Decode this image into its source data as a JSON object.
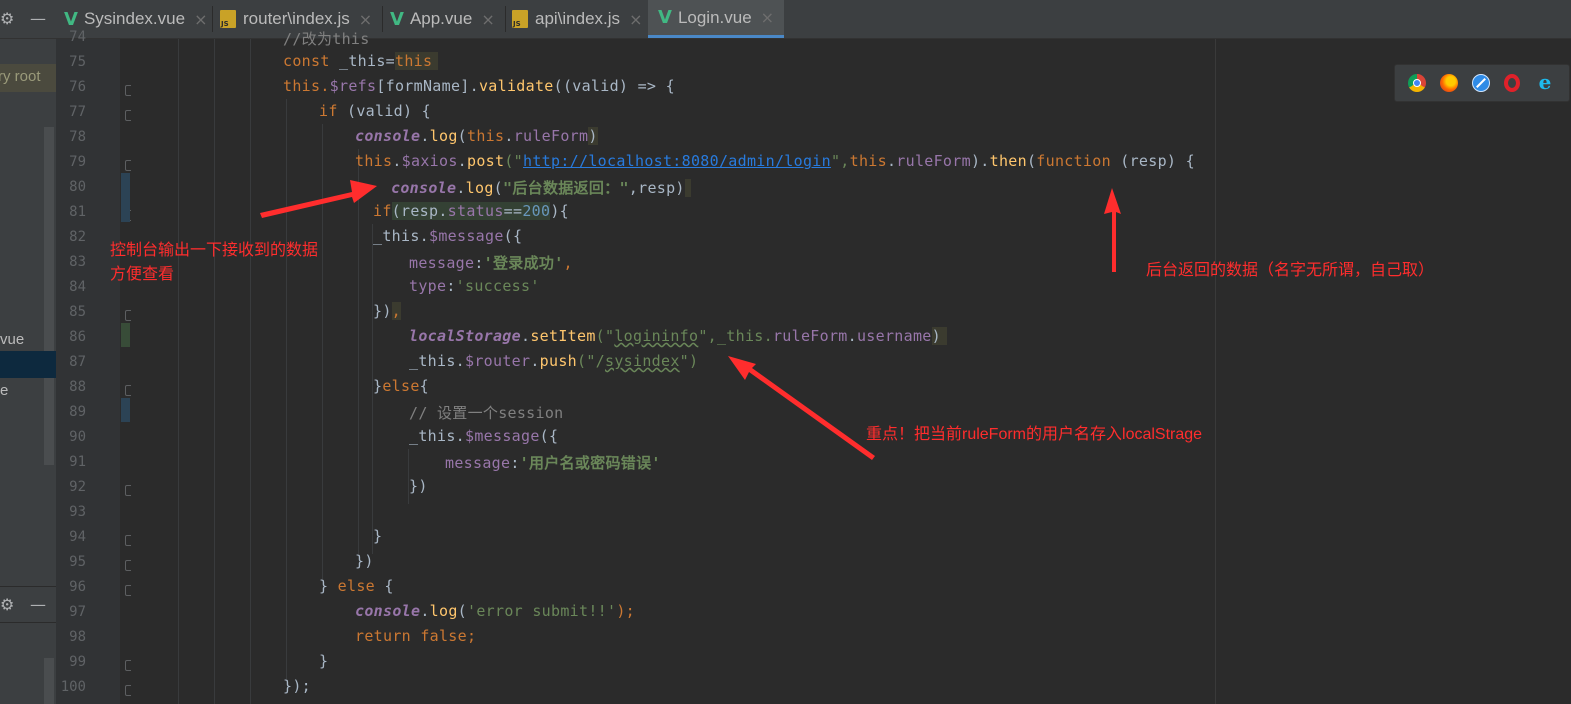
{
  "tabs": [
    {
      "label": "Sysindex.vue",
      "type": "vue"
    },
    {
      "label": "router\\index.js",
      "type": "js"
    },
    {
      "label": "App.vue",
      "type": "vue"
    },
    {
      "label": "api\\index.js",
      "type": "js"
    },
    {
      "label": "Login.vue",
      "type": "vue",
      "active": true
    }
  ],
  "tab_close": "×",
  "js_icon_text": "JS",
  "left_panel": {
    "root_text": "ry root",
    "vue_text": "vue",
    "e_text": "e"
  },
  "line_numbers": [
    "74",
    "75",
    "76",
    "77",
    "78",
    "79",
    "80",
    "81",
    "82",
    "83",
    "84",
    "85",
    "86",
    "87",
    "88",
    "89",
    "90",
    "91",
    "92",
    "93",
    "94",
    "95",
    "96",
    "97",
    "98",
    "99",
    "100"
  ],
  "code": {
    "l74": "//改为this",
    "l75": {
      "a": "const ",
      "b": "_this=",
      "c": "this"
    },
    "l76": {
      "a": "this.",
      "b": "$refs",
      "c": "[formName].",
      "d": "validate",
      "e": "((valid) => {"
    },
    "l77": {
      "a": "if ",
      "b": "(valid) {"
    },
    "l78": {
      "a": "console",
      "b": ".",
      "c": "log",
      "d": "(",
      "e": "this",
      "f": ".",
      "g": "ruleForm",
      "h": ")"
    },
    "l79": {
      "a": "this",
      "b": ".",
      "c": "$axios",
      "d": ".",
      "e": "post",
      "f": "(\"",
      "g": "http://localhost:8080/admin/login",
      "h": "\",",
      "i": "this",
      "j": ".",
      "k": "ruleForm",
      "l": ").",
      "m": "then",
      "n": "(",
      "o": "function ",
      "p": "(resp) {"
    },
    "l80": {
      "a": "console",
      "b": ".",
      "c": "log",
      "d": "(",
      "e": "\"后台数据返回：\"",
      "f": ",resp)"
    },
    "l81": {
      "a": "if",
      "b": "(resp.",
      "c": "status",
      "d": "==",
      "e": "200",
      "f": "){"
    },
    "l82": {
      "a": "_this.",
      "b": "$message",
      "c": "({"
    },
    "l83": {
      "a": "message",
      "b": ":",
      "c": "'登录成功'",
      "d": ","
    },
    "l84": {
      "a": "type",
      "b": ":",
      "c": "'success'"
    },
    "l85": {
      "a": "})",
      "b": ","
    },
    "l86": {
      "a": "localStorage",
      "b": ".",
      "c": "setItem",
      "d": "(\"",
      "e": "logininfo",
      "f": "\",_this.",
      "g": "ruleForm",
      "h": ".",
      "i": "username",
      "j": ")"
    },
    "l87": {
      "a": "_this.",
      "b": "$router",
      "c": ".",
      "d": "push",
      "e": "(\"/",
      "f": "sysindex",
      "g": "\")"
    },
    "l88": {
      "a": "}",
      "b": "else",
      "c": "{"
    },
    "l89": "// 设置一个session",
    "l90": {
      "a": "_this.",
      "b": "$message",
      "c": "({"
    },
    "l91": {
      "a": "message",
      "b": ":",
      "c": "'用户名或密码错误'"
    },
    "l92": "})",
    "l94": "}",
    "l95": "})",
    "l96": {
      "a": "} ",
      "b": "else ",
      "c": "{"
    },
    "l97": {
      "a": "console",
      "b": ".",
      "c": "log",
      "d": "(",
      "e": "'error submit!!'",
      "f": ");"
    },
    "l98": {
      "a": "return false",
      "b": ";"
    },
    "l99": "}",
    "l100": {
      "a": "});"
    }
  },
  "annotations": {
    "a1_line1": "控制台输出一下接收到的数据",
    "a1_line2": "方便查看",
    "a2": "后台返回的数据（名字无所谓，自己取）",
    "a3": "重点！把当前ruleForm的用户名存入localStrage"
  },
  "colors": {
    "accent": "#4a88c7",
    "annotation": "#ff2d2d",
    "editor_bg": "#2b2b2b"
  },
  "browsers": [
    "chrome-icon",
    "firefox-icon",
    "safari-icon",
    "opera-icon",
    "ie-icon"
  ]
}
